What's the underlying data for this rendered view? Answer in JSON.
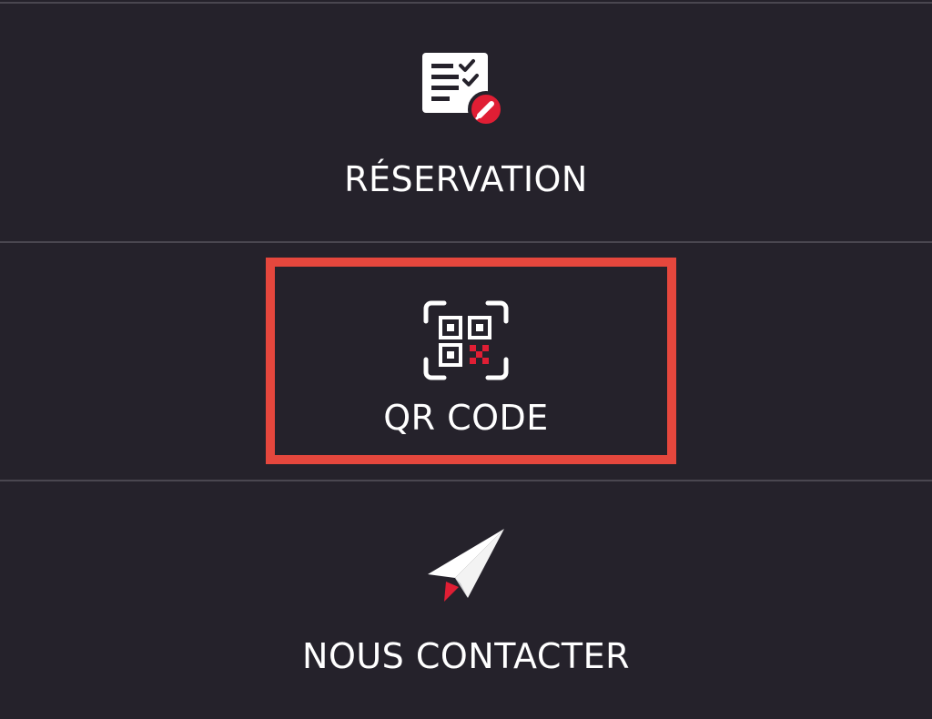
{
  "menu": {
    "items": [
      {
        "label": "RÉSERVATION",
        "icon": "reservation-checklist-icon"
      },
      {
        "label": "QR CODE",
        "icon": "qr-code-icon"
      },
      {
        "label": "NOUS CONTACTER",
        "icon": "paper-plane-icon"
      }
    ],
    "highlighted_index": 1
  },
  "colors": {
    "background": "#25222b",
    "divider": "#4a4750",
    "text": "#ffffff",
    "accent_red": "#e01e34",
    "highlight_border": "#e5473d"
  }
}
